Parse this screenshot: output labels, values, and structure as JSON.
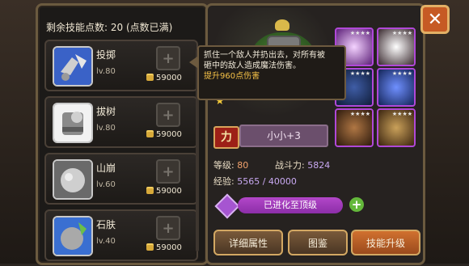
{
  "left_panel": {
    "header": "剩余技能点数: 20 (点数已满)",
    "skills": [
      {
        "name": "投掷",
        "level": "lv.80",
        "cost": "59000",
        "icon": "throw-icon"
      },
      {
        "name": "拔树",
        "level": "lv.80",
        "cost": "59000",
        "icon": "uproot-icon"
      },
      {
        "name": "山崩",
        "level": "lv.60",
        "cost": "59000",
        "icon": "landslide-icon"
      },
      {
        "name": "石肤",
        "level": "lv.40",
        "cost": "59000",
        "icon": "stone-skin-icon"
      }
    ],
    "plus_symbol": "+"
  },
  "tooltip": {
    "line1": "抓住一个敌人并扔出去，对所有被",
    "line2": "砸中的敌人造成魔法伤害。",
    "line3": "提升960点伤害"
  },
  "hero": {
    "name": "小小+3",
    "power_badge": "力",
    "level_label": "等级:",
    "level_value": "80",
    "combat_label": "战斗力:",
    "combat_value": "5824",
    "exp_label": "经验:",
    "exp_value": "5565 / 40000",
    "evolve_label": "已进化至顶级",
    "stars": [
      "★",
      "★"
    ]
  },
  "buttons": {
    "details": "详细属性",
    "atlas": "图鉴",
    "upgrade": "技能升级",
    "close": "✕",
    "plus_green": "+"
  },
  "equip_stars": "★★★★",
  "colors": {
    "accent_orange": "#f3a36d",
    "accent_purple": "#c9a9f2"
  }
}
